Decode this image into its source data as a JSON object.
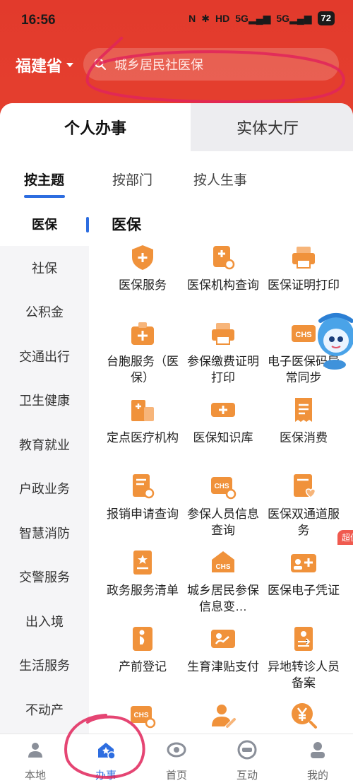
{
  "status": {
    "time": "16:56",
    "battery": "72",
    "signal1": "5G",
    "signal2": "5G",
    "hd": "HD"
  },
  "header": {
    "province": "福建省",
    "search_placeholder": "城乡居民社医保"
  },
  "tabs": {
    "personal": "个人办事",
    "hall": "实体大厅"
  },
  "subtabs": [
    "按主题",
    "按部门",
    "按人生事"
  ],
  "sidebar": [
    "医保",
    "社保",
    "公积金",
    "交通出行",
    "卫生健康",
    "教育就业",
    "户政业务",
    "智慧消防",
    "交警服务",
    "出入境",
    "生活服务",
    "不动产"
  ],
  "section_title": "医保",
  "services": [
    {
      "label": "医保服务",
      "icon": "shield-plus-icon"
    },
    {
      "label": "医保机构查询",
      "icon": "clinic-search-icon"
    },
    {
      "label": "医保证明打印",
      "icon": "printer-icon"
    },
    {
      "label": "台胞服务（医保）",
      "icon": "medkit-icon"
    },
    {
      "label": "参保缴费证明打印",
      "icon": "printer-icon"
    },
    {
      "label": "电子医保码异常同步",
      "icon": "chs-card-icon"
    },
    {
      "label": "定点医疗机构",
      "icon": "hospital-building-icon"
    },
    {
      "label": "医保知识库",
      "icon": "ticket-plus-icon"
    },
    {
      "label": "医保消费",
      "icon": "receipt-icon"
    },
    {
      "label": "报销申请查询",
      "icon": "doc-search-icon"
    },
    {
      "label": "参保人员信息查询",
      "icon": "chs-search-icon"
    },
    {
      "label": "医保双通道服务",
      "icon": "doc-heart-icon"
    },
    {
      "label": "政务服务清单",
      "icon": "doc-star-icon"
    },
    {
      "label": "城乡居民参保信息变…",
      "icon": "chs-edit-icon"
    },
    {
      "label": "医保电子凭证",
      "icon": "id-card-plus-icon",
      "badge": "超便捷"
    },
    {
      "label": "产前登记",
      "icon": "pregnant-icon"
    },
    {
      "label": "生育津贴支付",
      "icon": "baby-card-icon"
    },
    {
      "label": "异地转诊人员备案",
      "icon": "transfer-doc-icon"
    },
    {
      "label": "",
      "icon": "chs-transfer-icon"
    },
    {
      "label": "",
      "icon": "person-edit-icon"
    },
    {
      "label": "",
      "icon": "yen-search-icon"
    }
  ],
  "bottom_nav": [
    {
      "label": "本地",
      "icon": "local-person-icon"
    },
    {
      "label": "办事",
      "icon": "service-house-icon",
      "active": true
    },
    {
      "label": "首页",
      "icon": "home-logo-icon"
    },
    {
      "label": "互动",
      "icon": "hotline-12345-icon"
    },
    {
      "label": "我的",
      "icon": "profile-icon"
    }
  ],
  "colors": {
    "brand_red": "#e23a2c",
    "accent_blue": "#2d6de0",
    "icon_orange": "#f0923b"
  }
}
